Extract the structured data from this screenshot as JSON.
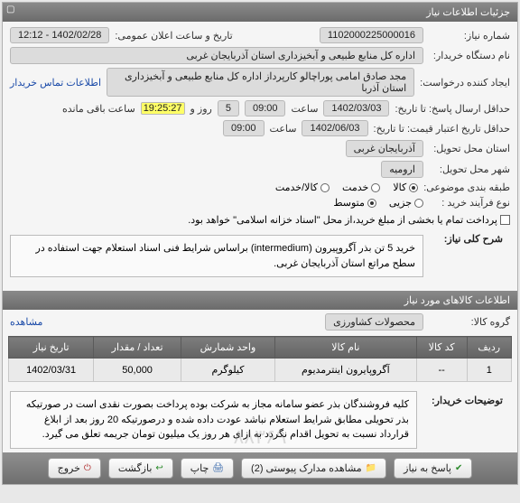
{
  "panel": {
    "title": "جزئیات اطلاعات نیاز"
  },
  "fields": {
    "need_no_label": "شماره نیاز:",
    "need_no": "1102000225000016",
    "announce_label": "تاریخ و ساعت اعلان عمومی:",
    "announce_value": "1402/02/28 - 12:12",
    "buyer_org_label": "نام دستگاه خریدار:",
    "buyer_org": "اداره کل منابع طبیعی و آبخیزداری استان آذربایجان غربی",
    "creator_label": "ایجاد کننده درخواست:",
    "creator": "مجد صادق امامی پوراچالو کارپرداز اداره کل منابع طبیعی و آبخیزداری استان آذربا",
    "contact_link": "اطلاعات تماس خریدار",
    "deadline_label": "حداقل ارسال پاسخ: تا تاریخ:",
    "deadline_date": "1402/03/03",
    "time_label": "ساعت",
    "deadline_time": "09:00",
    "days": "5",
    "and_label": "روز و",
    "remaining_time": "19:25:27",
    "remaining_label": "ساعت باقی مانده",
    "price_valid_label": "حداقل تاریخ اعتبار قیمت: تا تاریخ:",
    "price_valid_date": "1402/06/03",
    "price_valid_time": "09:00",
    "exec_province_label": "استان محل تحویل:",
    "exec_province": "آذربایجان غربی",
    "city_label": "شهر محل تحویل:",
    "city": "ارومیه",
    "category_label": "طبقه بندی موضوعی:",
    "cat_goods": "کالا",
    "cat_service": "خدمت",
    "cat_both": "کالا/خدمت",
    "process_label": "نوع فرآیند خرید :",
    "proc_small": "جزیی",
    "proc_medium": "متوسط",
    "pay_check_label": "پرداخت تمام یا بخشی از مبلغ خرید،از محل \"اسناد خزانه اسلامی\" خواهد بود."
  },
  "description": {
    "label": "شرح کلی نیاز:",
    "text": "خرید 5 تن بذر آگروپیرون (intermedium) براساس شرایط فنی اسناد استعلام جهت استفاده در سطح مراتع استان آذربایجان غربی."
  },
  "items_section": {
    "header": "اطلاعات کالاهای مورد نیاز",
    "group_label": "گروه کالا:",
    "group_value": "محصولات کشاورزی",
    "view_label": "مشاهده",
    "headers": {
      "row": "ردیف",
      "code": "کد کالا",
      "name": "نام کالا",
      "unit": "واحد شمارش",
      "qty": "تعداد / مقدار",
      "date": "تاریخ نیاز"
    },
    "rows": [
      {
        "row": "1",
        "code": "--",
        "name": "آگروپایرون اینترمدیوم",
        "unit": "کیلوگرم",
        "qty": "50,000",
        "date": "1402/03/31"
      }
    ]
  },
  "buyer_notes": {
    "label": "توضیحات خریدار:",
    "text": "کلیه فروشندگان بذر عضو سامانه مجاز به شرکت بوده پرداخت بصورت نقدی است در صورتیکه بذر تحویلی مطابق شرایط استعلام نباشد عودت داده شده و درصورتیکه 20 روز بعد از ابلاغ قرارداد نسبت به تحویل اقدام نگردد به ازای هر روز یک میلیون تومان جریمه تعلق می گیرد."
  },
  "watermark": "۸۸۳۶۹",
  "buttons": {
    "respond": "پاسخ به نیاز",
    "attachments": "مشاهده مدارک پیوستی (2)",
    "print": "چاپ",
    "back": "بازگشت",
    "exit": "خروج"
  }
}
